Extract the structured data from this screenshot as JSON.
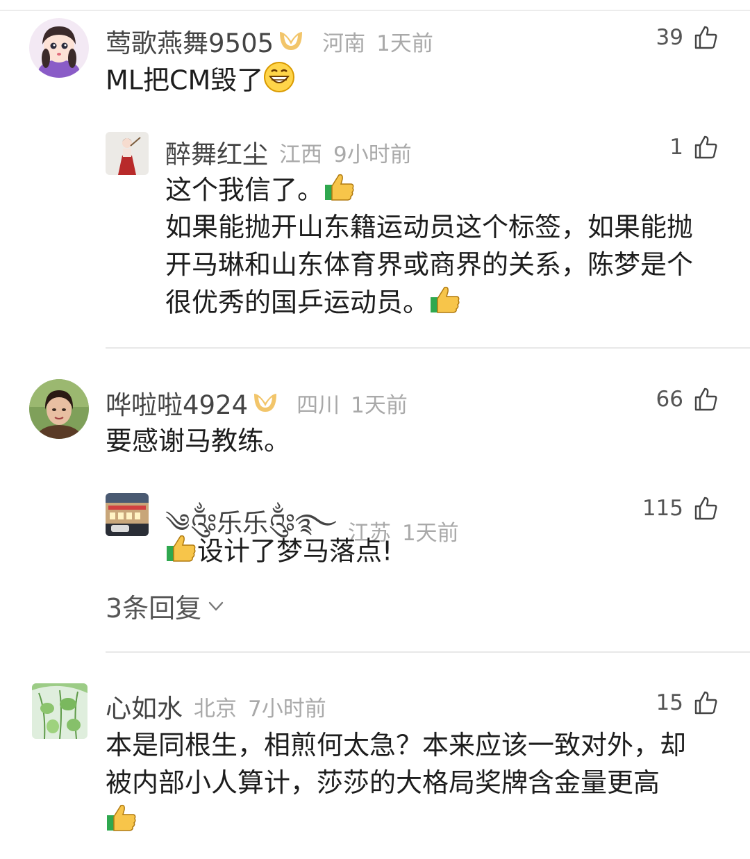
{
  "comments": [
    {
      "user": "莺歌燕舞9505",
      "location": "河南",
      "time": "1天前",
      "likes": "39",
      "text": "ML把CM毁了",
      "replies": [
        {
          "user": "醉舞红尘",
          "location": "江西",
          "time": "9小时前",
          "likes": "1",
          "lines": [
            "这个我信了。",
            "如果能抛开山东籍运动员这个标签，如果能抛",
            "开马琳和山东体育界或商界的关系，陈梦是个",
            "很优秀的国乒运动员。"
          ]
        }
      ]
    },
    {
      "user": "哗啦啦4924",
      "location": "四川",
      "time": "1天前",
      "likes": "66",
      "text": "要感谢马教练。",
      "replies": [
        {
          "user": "༄༂乐乐༂࿐",
          "location": "江苏",
          "time": "1天前",
          "likes": "115",
          "text": "设计了梦马落点!"
        }
      ],
      "more_replies": "3条回复"
    },
    {
      "user": "心如水",
      "location": "北京",
      "time": "7小时前",
      "likes": "15",
      "lines": [
        "本是同根生，相煎何太急？本来应该一致对外，却",
        "被内部小人算计，莎莎的大格局奖牌含金量更高"
      ]
    }
  ],
  "icons": {
    "like": "thumbs-up-outline-icon",
    "vip": "vip-badge-icon",
    "emoji_thumb": "thumbs-up-emoji-icon",
    "emoji_grin": "grinning-face-emoji-icon",
    "expand": "chevron-down-icon"
  },
  "colors": {
    "vip_badge": "#f2c56a",
    "meta_gray": "#a9a9a9",
    "thumb_emoji": "#f7c54a",
    "thumb_cuff": "#2fa84f"
  }
}
